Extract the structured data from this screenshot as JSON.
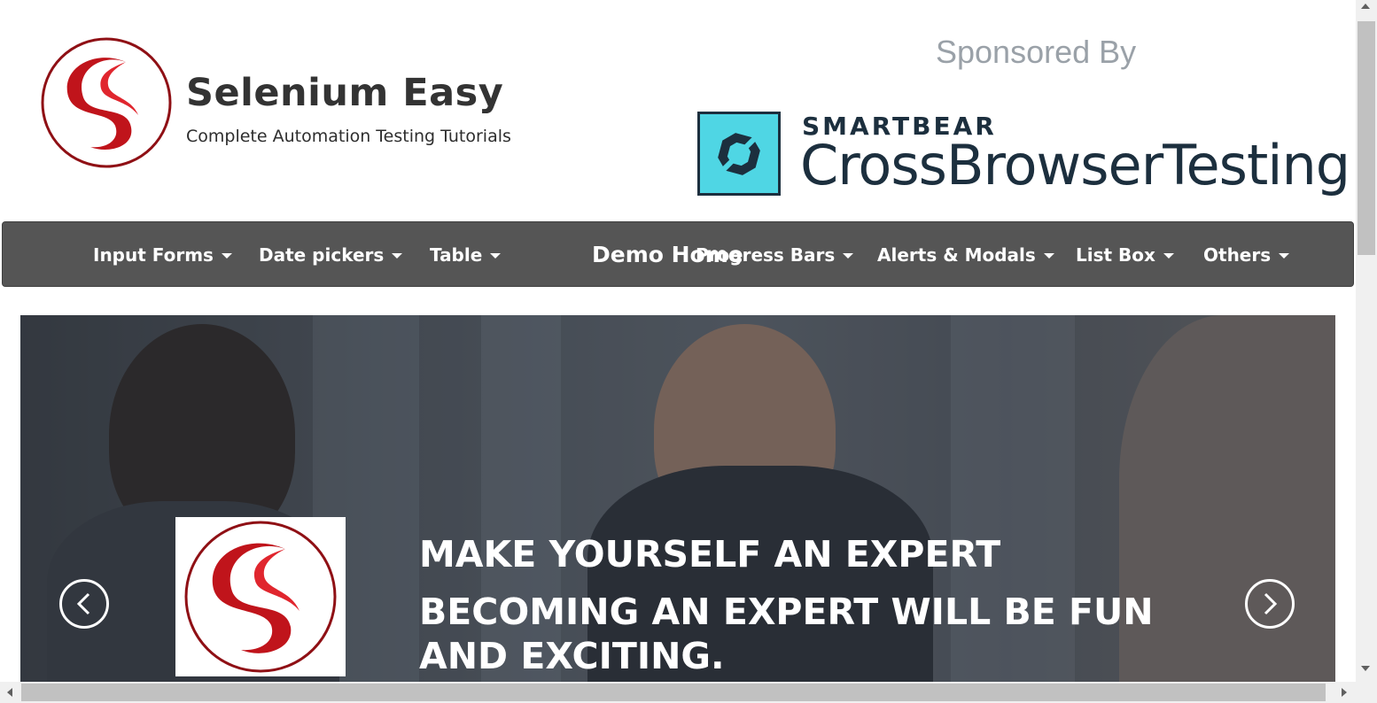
{
  "header": {
    "brand_name": "Selenium Easy",
    "tagline": "Complete Automation Testing Tutorials",
    "sponsor_label": "Sponsored By",
    "sponsor_company": "SMARTBEAR",
    "sponsor_product": "CrossBrowserTesting",
    "logo_icon": "selenium-easy-s-logo",
    "sponsor_icon": "crossbrowsertesting-logo"
  },
  "nav": {
    "home": "Demo Home",
    "items": [
      {
        "label": "Input Forms"
      },
      {
        "label": "Date pickers"
      },
      {
        "label": "Table"
      },
      {
        "label": "Progress Bars"
      },
      {
        "label": "Alerts & Modals"
      },
      {
        "label": "List Box"
      },
      {
        "label": "Others"
      }
    ]
  },
  "carousel": {
    "title": "MAKE YOURSELF AN EXPERT",
    "subtitle": "BECOMING AN EXPERT WILL BE FUN AND EXCITING.",
    "prev_icon": "chevron-left-icon",
    "next_icon": "chevron-right-icon"
  },
  "colors": {
    "navbar": "#555555",
    "brand_red": "#c0141b",
    "sponsor_teal": "#4fd6e4",
    "sponsor_navy": "#1c2f3e"
  }
}
